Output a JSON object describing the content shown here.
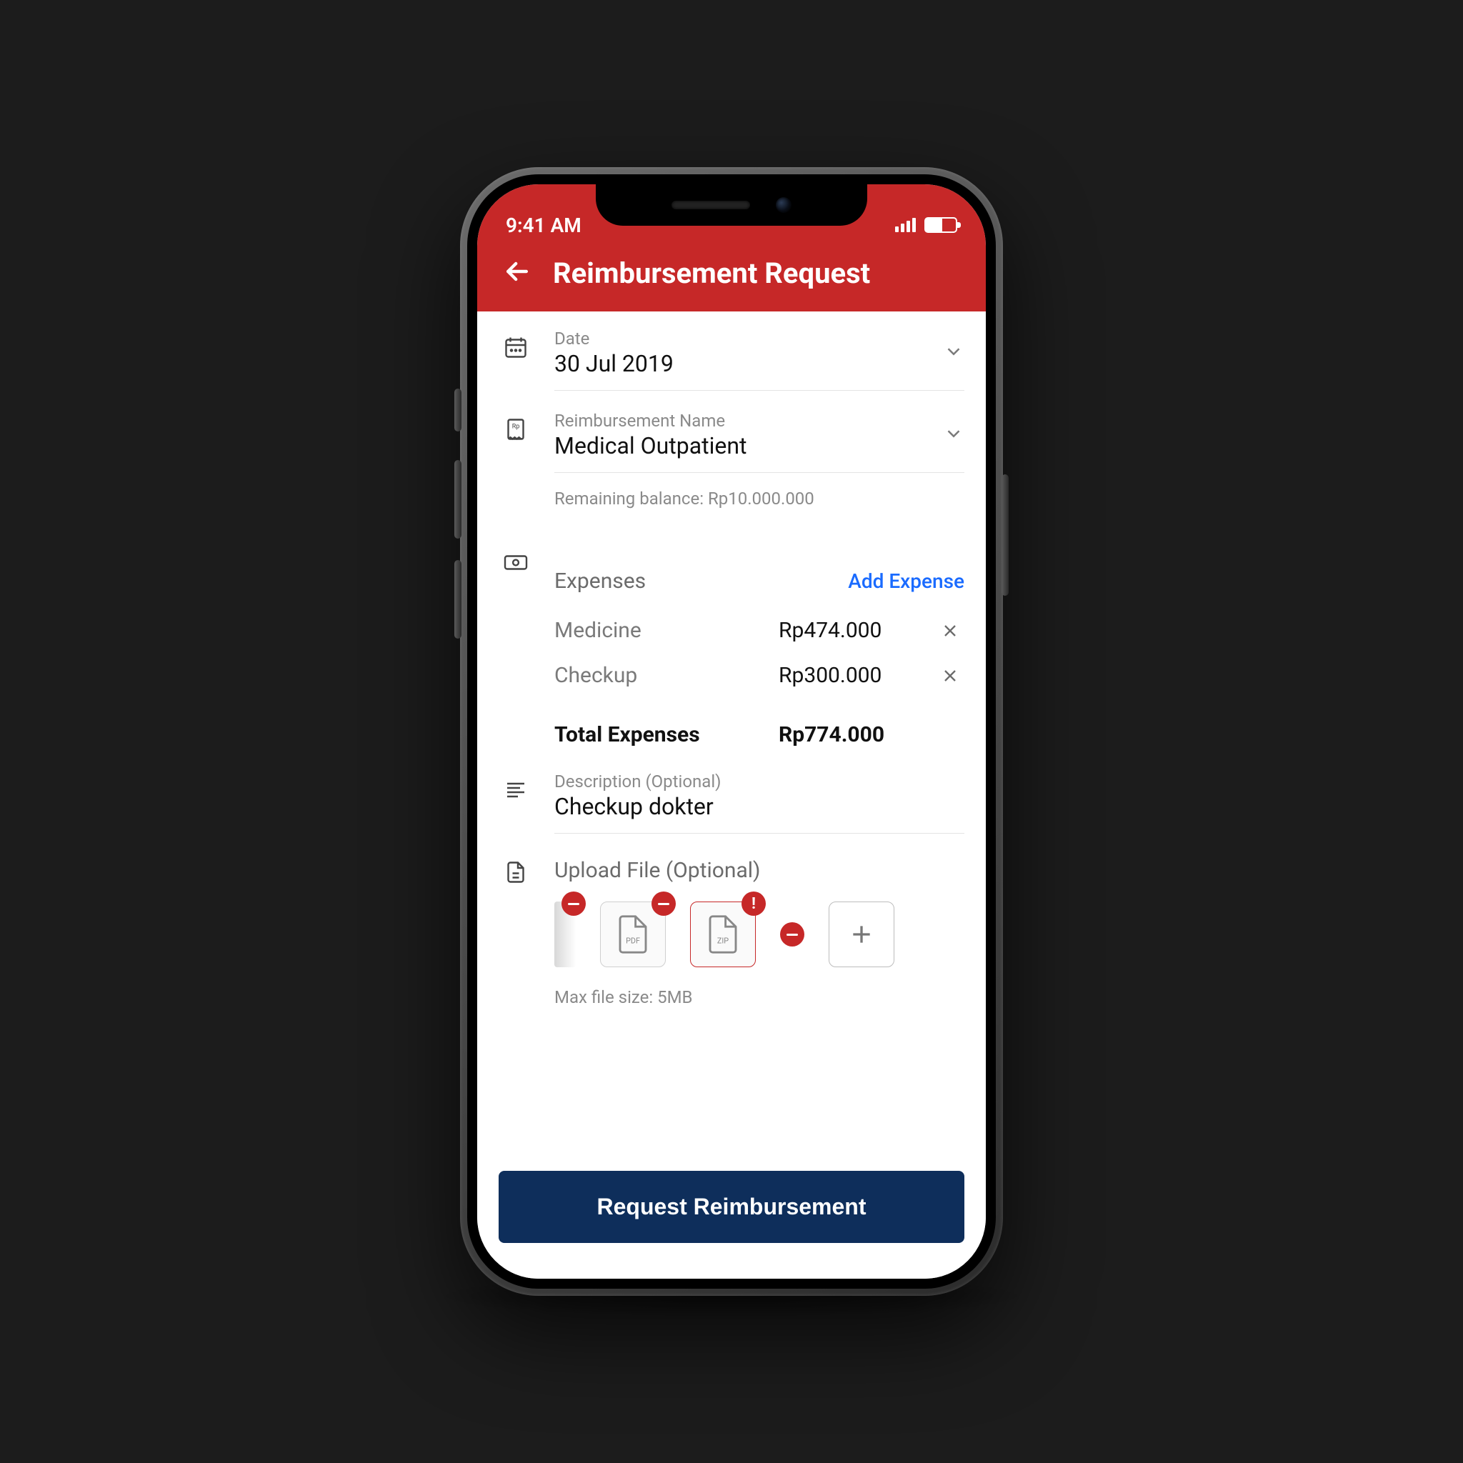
{
  "status": {
    "time": "9:41 AM"
  },
  "header": {
    "title": "Reimbursement Request"
  },
  "date": {
    "label": "Date",
    "value": "30 Jul 2019"
  },
  "reimbursement": {
    "label": "Reimbursement Name",
    "value": "Medical Outpatient",
    "balance": "Remaining balance: Rp10.000.000"
  },
  "expenses": {
    "title": "Expenses",
    "add_label": "Add Expense",
    "items": [
      {
        "name": "Medicine",
        "amount": "Rp474.000"
      },
      {
        "name": "Checkup",
        "amount": "Rp300.000"
      }
    ],
    "total_label": "Total Expenses",
    "total_value": "Rp774.000"
  },
  "description": {
    "label": "Description (Optional)",
    "value": "Checkup dokter"
  },
  "upload": {
    "title": "Upload File (Optional)",
    "files": [
      {
        "type": "image",
        "error": false
      },
      {
        "type": "pdf",
        "error": false
      },
      {
        "type": "zip",
        "error": true
      }
    ],
    "max_note": "Max file size: 5MB"
  },
  "footer": {
    "submit_label": "Request Reimbursement"
  },
  "colors": {
    "accent": "#C62828",
    "primary": "#0E2E5B",
    "link": "#1a6bff"
  }
}
